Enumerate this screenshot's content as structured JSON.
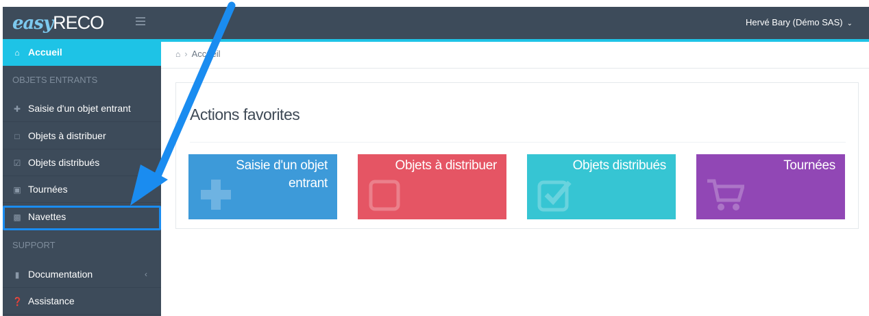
{
  "brand": {
    "logo_easy": "easy",
    "logo_reco": "RECO"
  },
  "header": {
    "user_label": "Hervé Bary (Démo SAS)"
  },
  "sidebar": {
    "active": {
      "label": "Accueil",
      "icon": "home-icon"
    },
    "section_incoming": "OBJETS ENTRANTS",
    "items": [
      {
        "label": "Saisie d'un objet entrant",
        "icon": "plus-icon"
      },
      {
        "label": "Objets à distribuer",
        "icon": "square-icon"
      },
      {
        "label": "Objets distribués",
        "icon": "check-square-icon"
      },
      {
        "label": "Tournées",
        "icon": "cart-icon"
      },
      {
        "label": "Navettes",
        "icon": "truck-icon"
      }
    ],
    "section_support": "SUPPORT",
    "support_items": [
      {
        "label": "Documentation",
        "icon": "book-icon"
      },
      {
        "label": "Assistance",
        "icon": "question-icon"
      }
    ]
  },
  "breadcrumb": {
    "current": "Accueil"
  },
  "main": {
    "panel_title": "Actions favorites",
    "tiles": [
      {
        "label": "Saisie d'un objet entrant",
        "color": "#3d9ad9",
        "icon": "plus-icon"
      },
      {
        "label": "Objets à distribuer",
        "color": "#e55564",
        "icon": "square-icon"
      },
      {
        "label": "Objets distribués",
        "color": "#36c5d3",
        "icon": "check-square-icon"
      },
      {
        "label": "Tournées",
        "color": "#9147b5",
        "icon": "cart-icon"
      }
    ]
  },
  "colors": {
    "topbar": "#3d4b5a",
    "accent": "#1ec3e6",
    "highlight": "#1a8cf0"
  }
}
